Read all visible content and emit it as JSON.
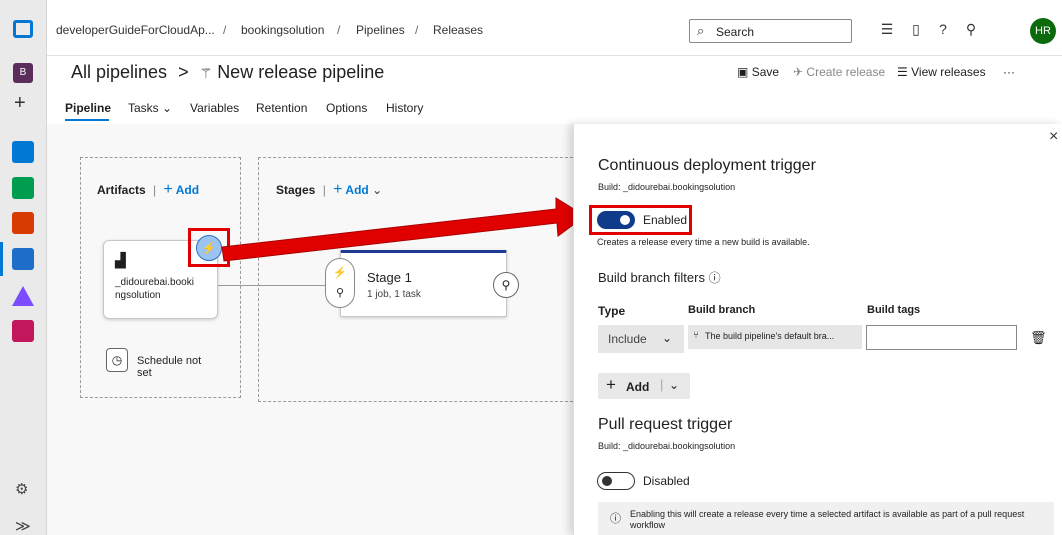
{
  "breadcrumb": {
    "org": "developerGuideForCloudAp...",
    "project": "bookingsolution",
    "section": "Pipelines",
    "page": "Releases",
    "sep": "/"
  },
  "search": {
    "label": "Search"
  },
  "avatar": {
    "initials": "HR"
  },
  "header": {
    "back": "All pipelines",
    "chevron": ">",
    "title": "New release pipeline"
  },
  "toolbar": {
    "save": "Save",
    "create_release": "Create release",
    "view_releases": "View releases",
    "more": "···"
  },
  "tabs": [
    "Pipeline",
    "Tasks",
    "Variables",
    "Retention",
    "Options",
    "History"
  ],
  "leftnav": {
    "org_badge": "B",
    "plus": "+",
    "expand": "≫"
  },
  "artifacts": {
    "title": "Artifacts",
    "add": "Add",
    "artifact_name": "_didourebai.booki ngsolution",
    "schedule": "Schedule not set"
  },
  "stages": {
    "title": "Stages",
    "add": "Add",
    "stage_name": "Stage 1",
    "stage_detail": "1 job, 1 task"
  },
  "panel": {
    "cd_title": "Continuous deployment trigger",
    "cd_build": "Build: _didourebai.bookingsolution",
    "cd_toggle": "Enabled",
    "cd_desc": "Creates a release every time a new build is available.",
    "filters_title": "Build branch filters",
    "col_type": "Type",
    "col_branch": "Build branch",
    "col_tags": "Build tags",
    "type_value": "Include",
    "branch_value": "The build pipeline's default bra...",
    "tags_value": "",
    "add": "Add",
    "pr_title": "Pull request trigger",
    "pr_build": "Build: _didourebai.bookingsolution",
    "pr_toggle": "Disabled",
    "pr_info": "Enabling this will create a release every time a selected artifact is available as part of a pull request workflow",
    "close": "×"
  },
  "colors": {
    "accent": "#0078d4",
    "highlight": "#e00000",
    "toggle_on": "#0f3c8a"
  }
}
